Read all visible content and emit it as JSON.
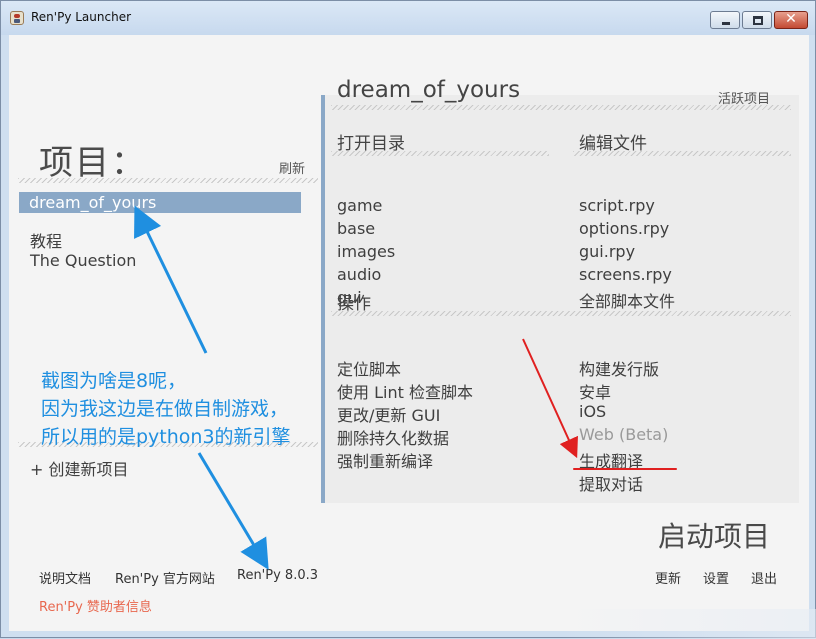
{
  "window": {
    "title": "Ren'Py Launcher",
    "close_glyph": "✕"
  },
  "left": {
    "title": "项目：",
    "refresh": "刷新",
    "projects": [
      "dream_of_yours",
      "教程",
      "The Question"
    ],
    "create_project": "+ 创建新项目"
  },
  "annotation": {
    "lines": [
      "截图为啥是8呢，",
      "因为我这边是在做自制游戏，",
      "所以用的是python3的新引擎"
    ],
    "color": "#1f8fe0"
  },
  "right": {
    "project_name": "dream_of_yours",
    "active_project": "活跃项目",
    "open_dir": {
      "title": "打开目录",
      "items": [
        "game",
        "base",
        "images",
        "audio",
        "gui"
      ]
    },
    "edit_file": {
      "title": "编辑文件",
      "items": [
        "script.rpy",
        "options.rpy",
        "gui.rpy",
        "screens.rpy",
        "全部脚本文件"
      ]
    },
    "actions": {
      "title": "操作",
      "left_items": [
        "定位脚本",
        "使用 Lint 检查脚本",
        "更改/更新 GUI",
        "删除持久化数据",
        "强制重新编译"
      ],
      "right_items": [
        "构建发行版",
        "安卓",
        "iOS",
        "Web (Beta)",
        "生成翻译",
        "提取对话"
      ]
    }
  },
  "footer": {
    "launch": "启动项目",
    "docs": "说明文档",
    "website": "Ren'Py 官方网站",
    "version": "Ren'Py 8.0.3",
    "update": "更新",
    "settings": "设置",
    "quit": "退出",
    "sponsors": "Ren'Py 赞助者信息"
  },
  "colors": {
    "accent": "#8aa8c7",
    "sponsor": "#e8684f",
    "highlight_underline": "#e02020",
    "annotation_arrow": "#1f8fe0"
  }
}
